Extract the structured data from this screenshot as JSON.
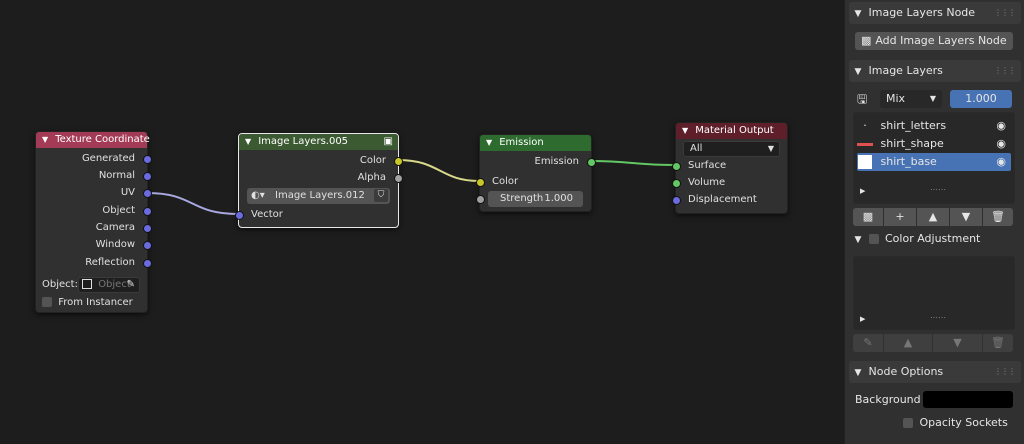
{
  "nodes": {
    "texture_coordinate": {
      "title": "Texture Coordinate",
      "outputs": [
        "Generated",
        "Normal",
        "UV",
        "Object",
        "Camera",
        "Window",
        "Reflection"
      ],
      "object_label": "Object:",
      "object_placeholder": "Object",
      "from_instancer": "From Instancer"
    },
    "image_layers": {
      "title": "Image Layers.005",
      "outputs": [
        "Color",
        "Alpha"
      ],
      "datablock": "Image Layers.012",
      "input": "Vector"
    },
    "emission": {
      "title": "Emission",
      "output": "Emission",
      "input_color": "Color",
      "strength_label": "Strength",
      "strength_value": "1.000"
    },
    "material_output": {
      "title": "Material Output",
      "target": "All",
      "inputs": [
        "Surface",
        "Volume",
        "Displacement"
      ]
    }
  },
  "panel": {
    "image_layers_node": {
      "title": "Image Layers Node",
      "add_button": "Add Image Layers Node"
    },
    "image_layers": {
      "title": "Image Layers",
      "blend_mode": "Mix",
      "opacity": "1.000",
      "layers": [
        "shirt_letters",
        "shirt_shape",
        "shirt_base"
      ],
      "active_layer": "shirt_base"
    },
    "color_adjustment": {
      "title": "Color Adjustment"
    },
    "node_options": {
      "title": "Node Options",
      "background_label": "Background",
      "opacity_sockets": "Opacity Sockets"
    }
  },
  "colors": {
    "header_texture": "#a33b57",
    "header_image_layers": "#3c5a32",
    "header_emission": "#2d6b2f",
    "header_output": "#5e1f2a",
    "accent_blue": "#4772b3"
  }
}
